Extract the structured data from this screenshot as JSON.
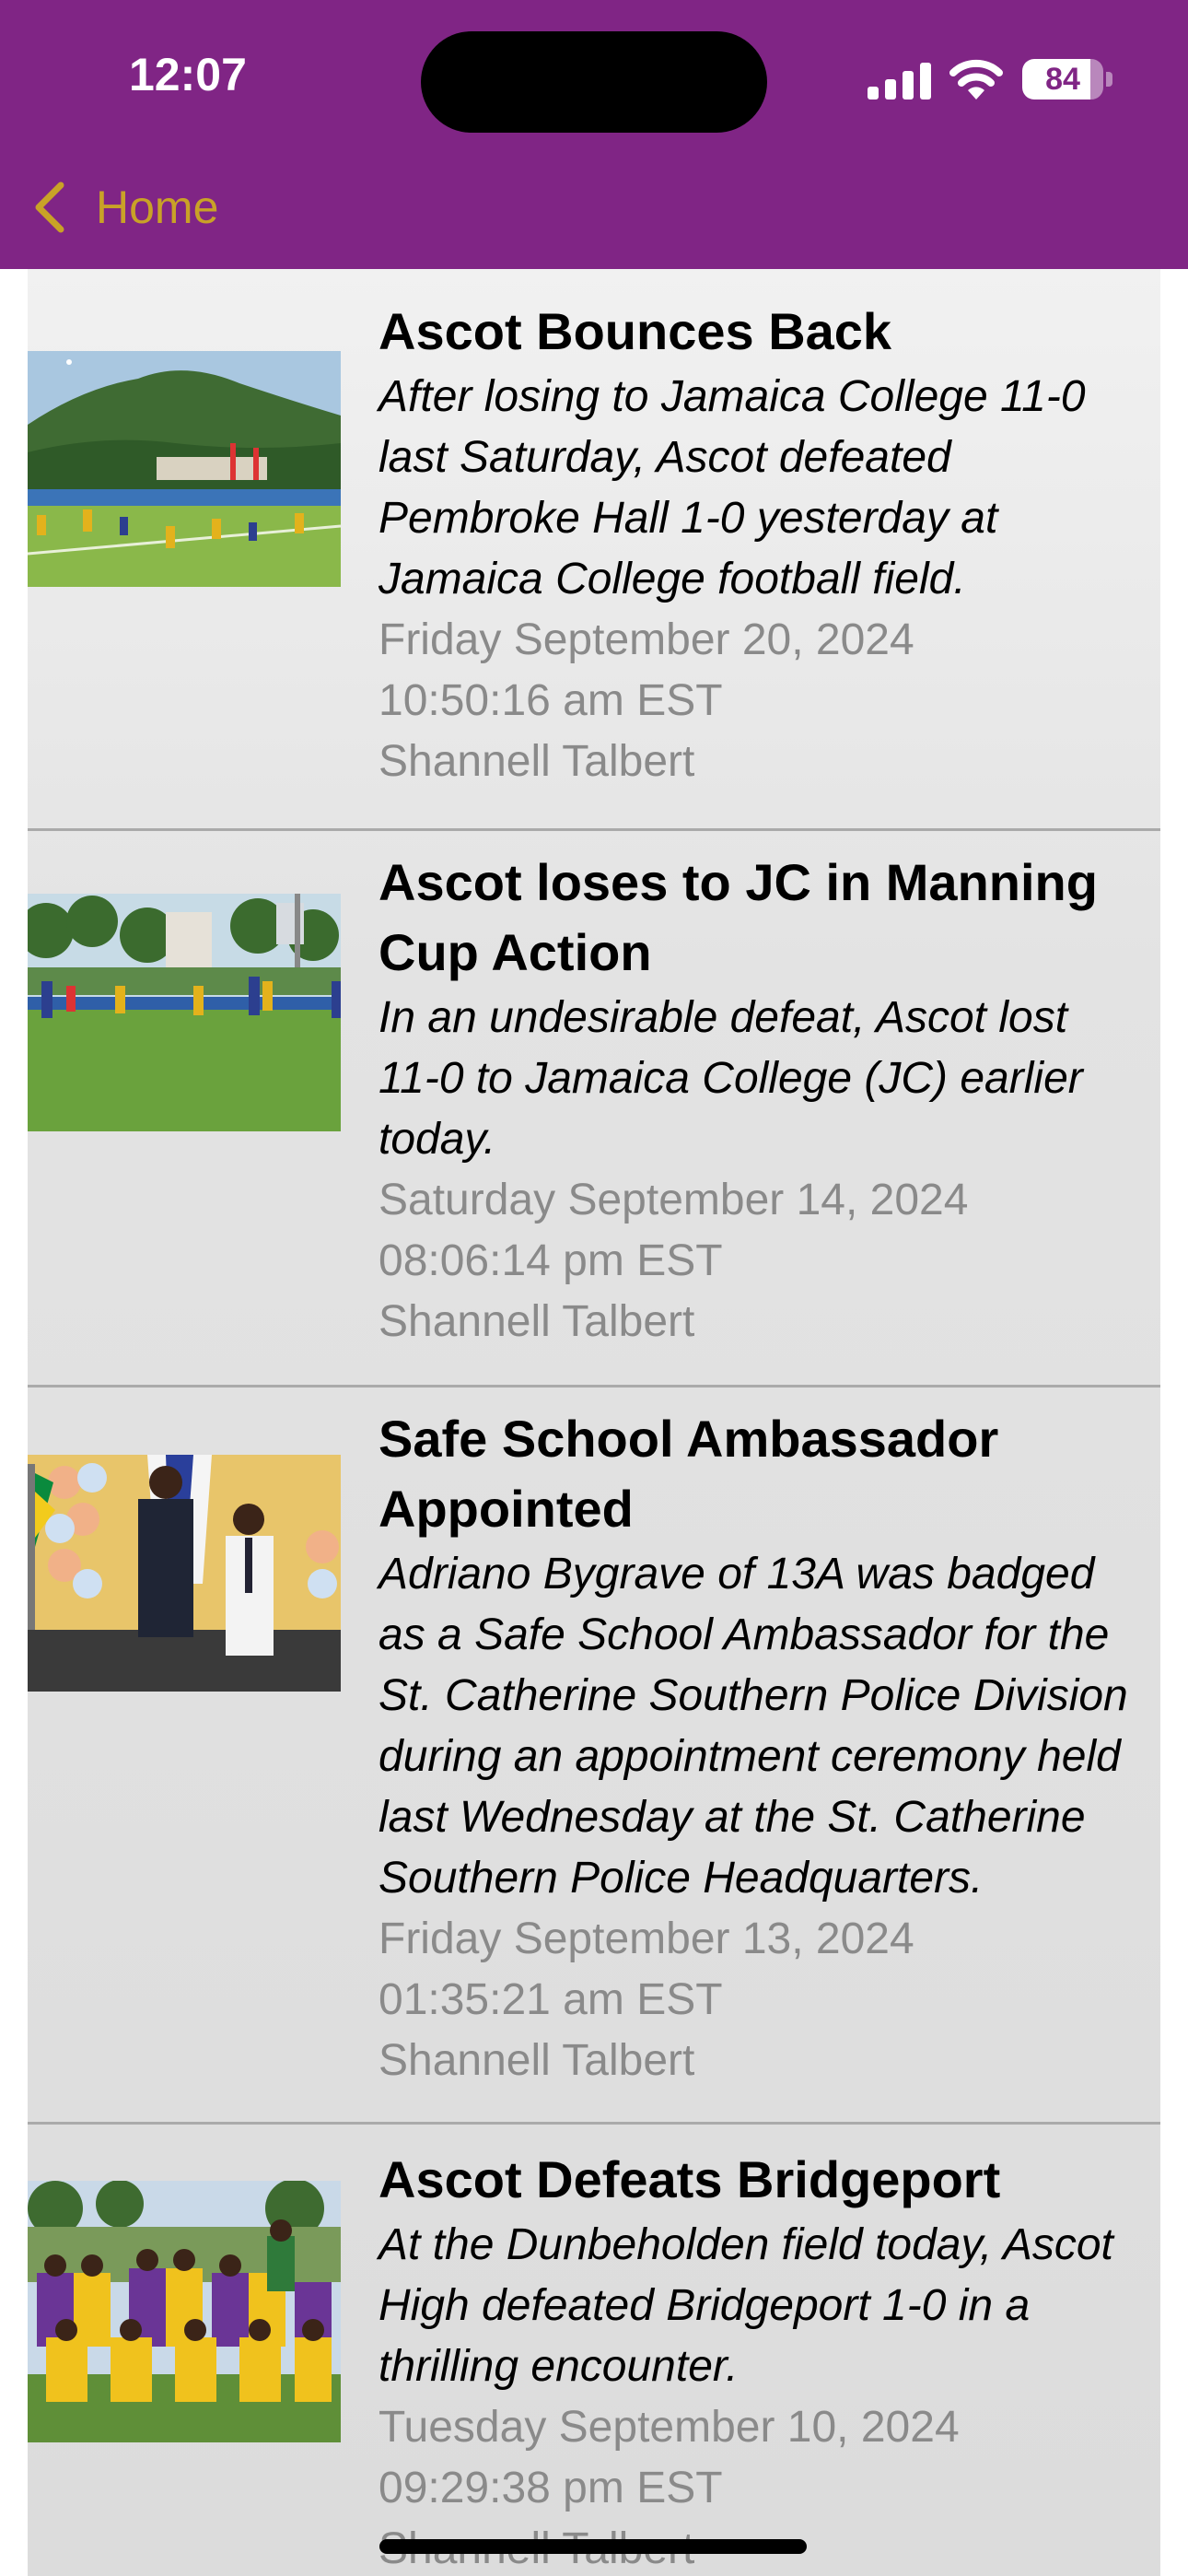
{
  "status_bar": {
    "time": "12:07",
    "battery_level": "84",
    "battery_fraction": 0.84
  },
  "nav": {
    "back_label": "Home",
    "back_color": "#C9A227",
    "bar_color": "#802585"
  },
  "articles": [
    {
      "title_lines": [
        "Ascot Bounces Back"
      ],
      "summary_lines": [
        "After losing to Jamaica College 11-0",
        "last Saturday, Ascot defeated",
        "Pembroke Hall 1-0 yesterday at",
        "Jamaica College football field."
      ],
      "date": "Friday September 20, 2024",
      "time": "10:50:16 am EST",
      "author": "Shannell Talbert",
      "thumbnail": "football-match-photo"
    },
    {
      "title_lines": [
        "Ascot loses to JC in Manning",
        "Cup Action"
      ],
      "summary_lines": [
        "In an undesirable defeat, Ascot lost",
        "11-0 to Jamaica College (JC) earlier",
        "today."
      ],
      "date": "Saturday September 14, 2024",
      "time": "08:06:14 pm EST",
      "author": "Shannell Talbert",
      "thumbnail": "football-field-photo"
    },
    {
      "title_lines": [
        "Safe School Ambassador",
        "Appointed"
      ],
      "summary_lines": [
        "Adriano Bygrave of 13A was badged",
        "as a Safe School Ambassador for the",
        "St. Catherine Southern Police Division",
        "during an appointment ceremony held",
        "last Wednesday at the St. Catherine",
        "Southern Police Headquarters."
      ],
      "date": "Friday September 13, 2024",
      "time": "01:35:21 am EST",
      "author": "Shannell Talbert",
      "thumbnail": "ceremony-photo"
    },
    {
      "title_lines": [
        "Ascot Defeats Bridgeport"
      ],
      "summary_lines": [
        "At the Dunbeholden field today, Ascot",
        "High defeated Bridgeport 1-0 in a",
        "thrilling encounter."
      ],
      "date": "Tuesday September 10, 2024",
      "time": "09:29:38 pm EST",
      "author": "Shannell Talbert",
      "thumbnail": "team-photo"
    }
  ]
}
